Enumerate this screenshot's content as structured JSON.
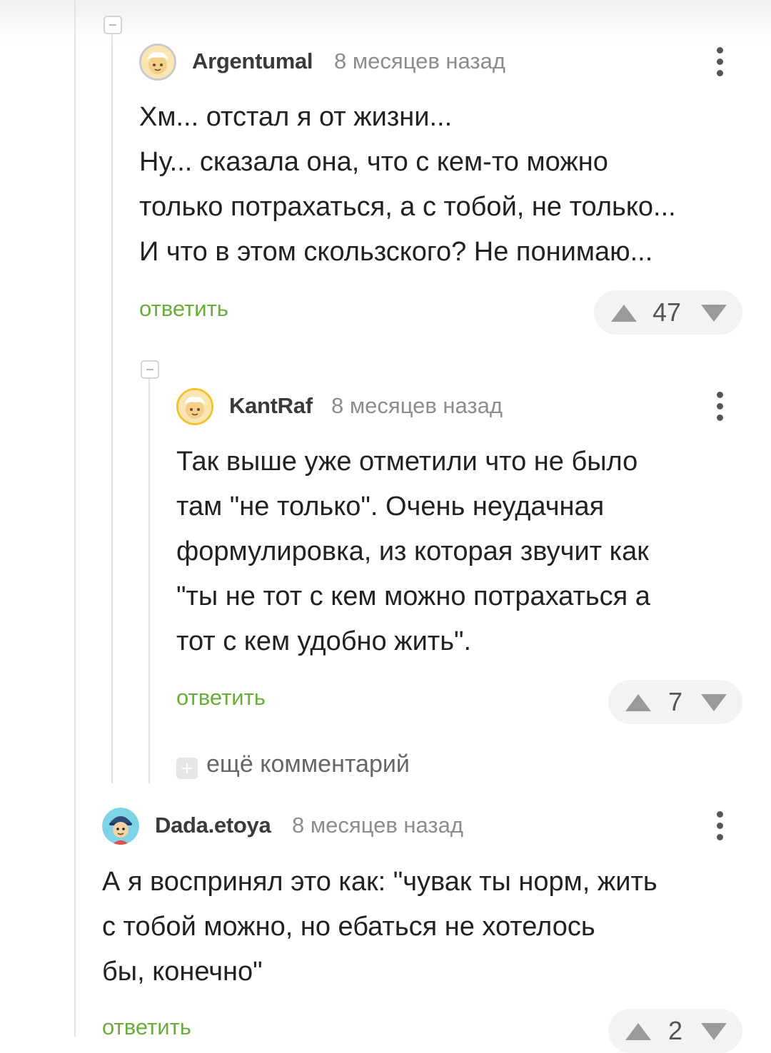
{
  "comments": [
    {
      "author": "Argentumal",
      "time": "8 месяцев назад",
      "text": "Хм... отстал я от жизни...\nНу... сказала она, что с кем-то можно\nтолько потрахаться, а с тобой, не только...\nИ что в этом скользского? Не понимаю...",
      "reply_label": "ответить",
      "rating": "47",
      "avatar_icon": "cat-avatar-icon"
    },
    {
      "author": "KantRaf",
      "time": "8 месяцев назад",
      "text": "Так выше уже отметили что не было\nтам \"не только\". Очень неудачная\nформулировка, из которая звучит как\n\"ты не тот с кем можно потрахаться а\nтот с кем удобно жить\".",
      "reply_label": "ответить",
      "rating": "7",
      "avatar_icon": "cat-avatar-icon"
    },
    {
      "author": "Dada.etoya",
      "time": "8 месяцев назад",
      "text": "А я воспринял это как: \"чувак ты норм, жить\nс тобой можно, но ебаться не хотелось\nбы, конечно\"",
      "reply_label": "ответить",
      "rating": "2",
      "avatar_icon": "cartoon-avatar-icon"
    }
  ],
  "more_comments_label": "ещё комментарий",
  "colors": {
    "reply_green": "#69ad3b",
    "thread_line": "#e2e2e2",
    "vote_pill": "#f3f3f5"
  }
}
